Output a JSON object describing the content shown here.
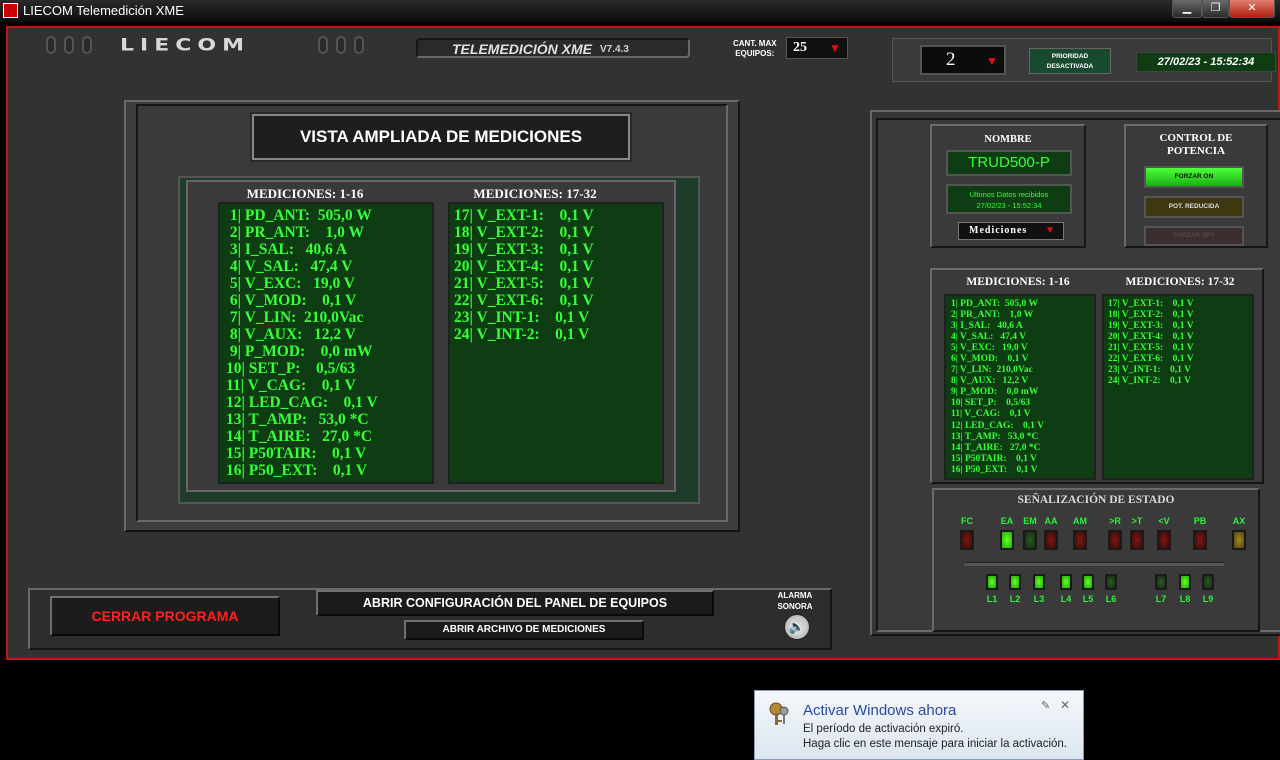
{
  "window": {
    "title": "LIECOM Telemedición XME"
  },
  "header": {
    "logo": "LIECOM",
    "app_title": "TELEMEDICIÓN XME",
    "version": "V7.4.3",
    "cant_max_label_1": "CANT. MAX",
    "cant_max_label_2": "EQUIPOS:",
    "cant_max_value": "25",
    "equipo_selected": "2",
    "priority_label_1": "PRIORIDAD",
    "priority_label_2": "DESACTIVADA",
    "datetime": "27/02/23 - 15:52:34"
  },
  "vista": {
    "title": "VISTA AMPLIADA DE MEDICIONES",
    "col1_header": "MEDICIONES: 1-16",
    "col2_header": "MEDICIONES: 17-32",
    "col1": [
      " 1| PD_ANT:  505,0 W",
      " 2| PR_ANT:    1,0 W",
      " 3| I_SAL:   40,6 A",
      " 4| V_SAL:   47,4 V",
      " 5| V_EXC:   19,0 V",
      " 6| V_MOD:    0,1 V",
      " 7| V_LIN:  210,0Vac",
      " 8| V_AUX:   12,2 V",
      " 9| P_MOD:    0,0 mW",
      "10| SET_P:    0,5/63",
      "11| V_CAG:    0,1 V",
      "12| LED_CAG:    0,1 V",
      "13| T_AMP:   53,0 *C",
      "14| T_AIRE:   27,0 *C",
      "15| P50TAIR:    0,1 V",
      "16| P50_EXT:    0,1 V"
    ],
    "col2": [
      "17| V_EXT-1:    0,1 V",
      "18| V_EXT-2:    0,1 V",
      "19| V_EXT-3:    0,1 V",
      "20| V_EXT-4:    0,1 V",
      "21| V_EXT-5:    0,1 V",
      "22| V_EXT-6:    0,1 V",
      "23| V_INT-1:    0,1 V",
      "24| V_INT-2:    0,1 V"
    ]
  },
  "bottom": {
    "close_label": "CERRAR PROGRAMA",
    "config_label": "ABRIR CONFIGURACIÓN DEL PANEL DE EQUIPOS",
    "file_label": "ABRIR ARCHIVO DE MEDICIONES",
    "alarm_label_1": "ALARMA",
    "alarm_label_2": "SONORA"
  },
  "right": {
    "nombre_label": "NOMBRE",
    "nombre_value": "TRUD500-P",
    "ultimos_label": "Ultimos Datos recibidos",
    "ultimos_value": "27/02/23 - 15:52:34",
    "mediciones_dropdown": "Mediciones",
    "control_title_1": "CONTROL DE",
    "control_title_2": "POTENCIA",
    "forzar_on": "FORZAR ON",
    "pot_reducida": "POT. REDUCIDA",
    "forzar_off": "FORZAR OFF",
    "small_col1_header": "MEDICIONES: 1-16",
    "small_col2_header": "MEDICIONES: 17-32",
    "small_col1": [
      "1| PD_ANT:  505,0 W",
      "2| PR_ANT:    1,0 W",
      "3| I_SAL:   40,6 A",
      "4| V_SAL:   47,4 V",
      "5| V_EXC:   19,0 V",
      "6| V_MOD:    0,1 V",
      "7| V_LIN:  210,0Vac",
      "8| V_AUX:   12,2 V",
      "9| P_MOD:    0,0 mW",
      "10| SET_P:    0,5/63",
      "11| V_CAG:    0,1 V",
      "12| LED_CAG:    0,1 V",
      "13| T_AMP:   53,0 *C",
      "14| T_AIRE:   27,0 *C",
      "15| P50TAIR:    0,1 V",
      "16| P50_EXT:    0,1 V"
    ],
    "small_col2": [
      "17| V_EXT-1:    0,1 V",
      "18| V_EXT-2:    0,1 V",
      "19| V_EXT-3:    0,1 V",
      "20| V_EXT-4:    0,1 V",
      "21| V_EXT-5:    0,1 V",
      "22| V_EXT-6:    0,1 V",
      "23| V_INT-1:    0,1 V",
      "24| V_INT-2:    0,1 V"
    ],
    "senal_title": "SEÑALIZACIÓN DE ESTADO",
    "leds_top": [
      {
        "label": "FC",
        "state": "red"
      },
      {
        "label": "EA",
        "state": "green"
      },
      {
        "label": "EM",
        "state": "darkgreen"
      },
      {
        "label": "AA",
        "state": "red"
      },
      {
        "label": "AM",
        "state": "red"
      },
      {
        "label": ">R",
        "state": "red"
      },
      {
        "label": ">T",
        "state": "red"
      },
      {
        "label": "<V",
        "state": "red"
      },
      {
        "label": "PB",
        "state": "red"
      },
      {
        "label": "AX",
        "state": "olive"
      }
    ],
    "leds_bottom": [
      {
        "label": "L1",
        "state": "green"
      },
      {
        "label": "L2",
        "state": "green"
      },
      {
        "label": "L3",
        "state": "green"
      },
      {
        "label": "L4",
        "state": "green"
      },
      {
        "label": "L5",
        "state": "green"
      },
      {
        "label": "L6",
        "state": "darkgreen"
      },
      {
        "label": "L7",
        "state": "darkgreen"
      },
      {
        "label": "L8",
        "state": "green"
      },
      {
        "label": "L9",
        "state": "darkgreen"
      }
    ]
  },
  "windows_popup": {
    "title": "Activar Windows ahora",
    "line1": "El período de activación expiró.",
    "line2": "Haga clic en este mensaje para iniciar la activación."
  },
  "colors": {
    "frame_red": "#c01616",
    "led_green": "#37ff37",
    "list_bg": "#0f3d13"
  }
}
